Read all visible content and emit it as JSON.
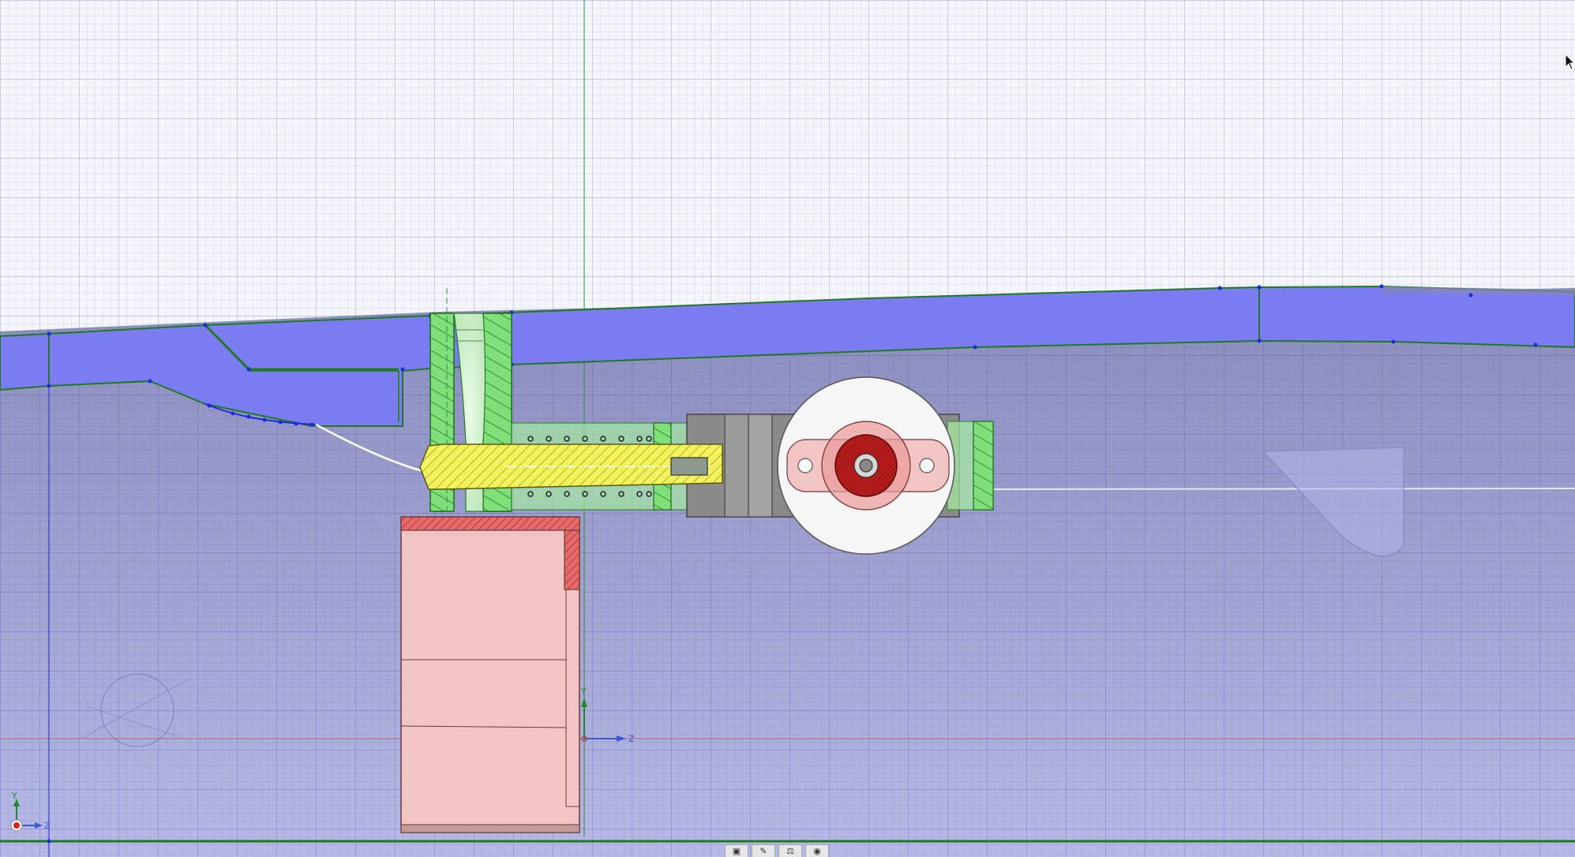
{
  "viewport": {
    "background_top": "#f4f6fb",
    "background_bottom_start": "#8888b8",
    "background_bottom_end": "#b8bce8",
    "grid_color": "#2c3a9a"
  },
  "colors": {
    "frame_blue": "#7b7cf2",
    "outline_green": "#1f7a1f",
    "part_green": "#a6f0a0",
    "shaft_yellow": "#f3f25a",
    "block_pink": "#f4c3c3",
    "hatch_red": "#d94848",
    "hub_red": "#b81c1c",
    "servo_gray": "#8a8a8a",
    "vertex_blue": "#1a2ae0"
  },
  "axes_triad": {
    "y_label": "Y",
    "z_label": "Z"
  },
  "origin_triad": {
    "y_label": "Y",
    "z_label": "Z"
  },
  "toolbar": {
    "buttons": [
      {
        "name": "view-box-icon",
        "glyph": "▣"
      },
      {
        "name": "sketch-pencil-icon",
        "glyph": "✎"
      },
      {
        "name": "measure-icon",
        "glyph": "⚖"
      },
      {
        "name": "visibility-eye-icon",
        "glyph": "◉"
      }
    ]
  }
}
